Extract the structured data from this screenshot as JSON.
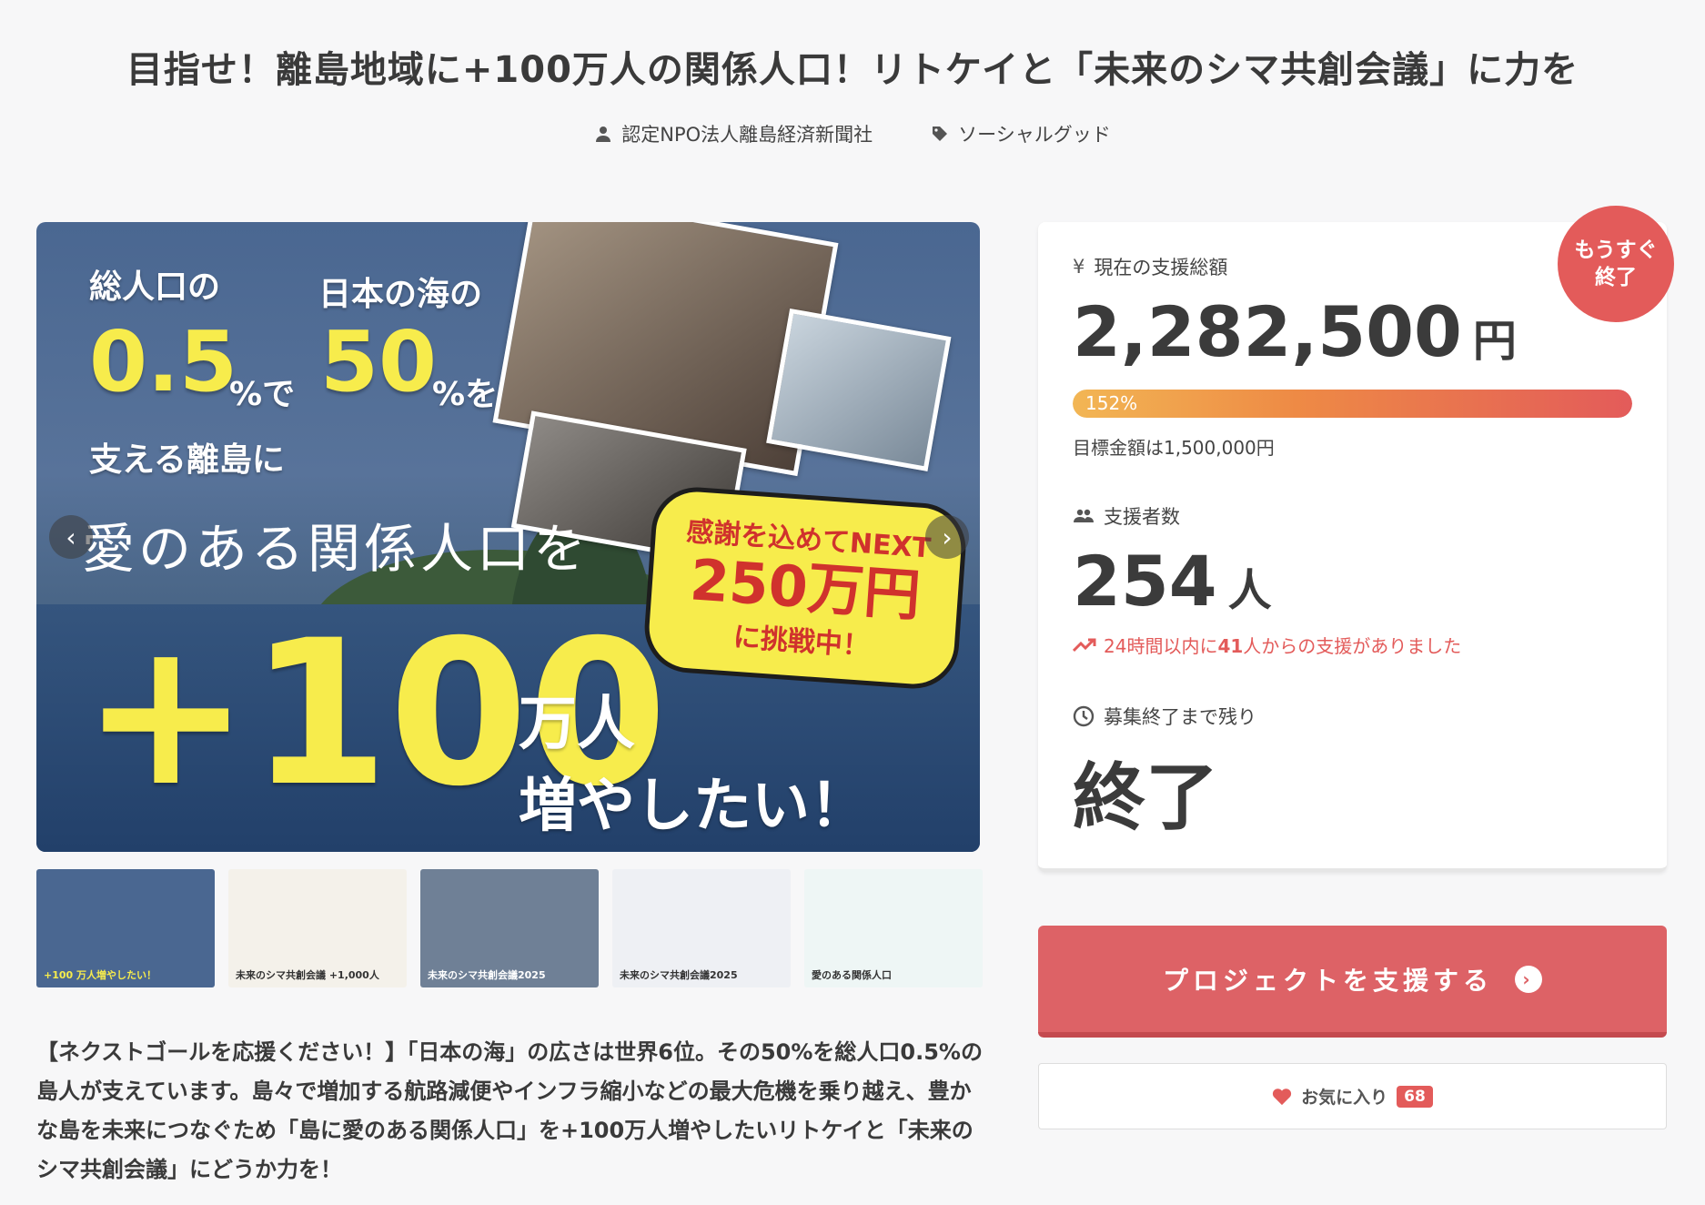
{
  "project": {
    "title": "目指せ！離島地域に+100万人の関係人口！リトケイと「未来のシマ共創会議」に力を",
    "owner": "認定NPO法人離島経済新聞社",
    "category": "ソーシャルグッド"
  },
  "hero": {
    "line1": "総人口の",
    "line2": "日本の海の",
    "num1": "0.5",
    "unit1": "%で",
    "num2": "50",
    "unit2": "%を",
    "line3": "支える離島に",
    "script": "愛のある関係人口を",
    "plus": "+100",
    "man": "万人",
    "want": "増やしたい！",
    "bubble_top": "感謝を込めてNEXT",
    "bubble_amount": "250万円",
    "bubble_bottom": "に挑戦中！",
    "prev_label": "‹",
    "next_label": "›"
  },
  "thumbnails": [
    {
      "caption": "+100 万人増やしたい！",
      "bg": "#4a6791"
    },
    {
      "caption": "未来のシマ共創会議 +1,000人",
      "bg": "#f4f1ea"
    },
    {
      "caption": "未来のシマ共創会議2025",
      "bg": "#6f8096"
    },
    {
      "caption": "未来のシマ共創会議2025",
      "bg": "#eef0f4"
    },
    {
      "caption": "愛のある関係人口",
      "bg": "#eef6f5"
    }
  ],
  "description": "【ネクストゴールを応援ください！】「日本の海」の広さは世界6位。その50%を総人口0.5%の島人が支えています。島々で増加する航路減便やインフラ縮小などの最大危機を乗り越え、豊かな島を未来につなぐため「島に愛のある関係人口」を+100万人増やしたいリトケイと「未来のシマ共創会議」にどうか力を！",
  "stats": {
    "badge": "もうすぐ\n終了",
    "badge_l1": "もうすぐ",
    "badge_l2": "終了",
    "amount_label": "現在の支援総額",
    "amount": "2,282,500",
    "amount_unit": "円",
    "progress_percent": 152,
    "progress_text": "152%",
    "goal_text": "目標金額は1,500,000円",
    "supporters_label": "支援者数",
    "supporters": "254",
    "supporters_unit": "人",
    "trend_prefix": "24時間以内に",
    "trend_count": "41",
    "trend_suffix": "人からの支援がありました",
    "remaining_label": "募集終了まで残り",
    "remaining": "終了"
  },
  "actions": {
    "support_label": "プロジェクトを支援する",
    "favorite_label": "お気に入り",
    "favorite_count": "68"
  },
  "colors": {
    "accent": "#e35b5a",
    "button": "#dd6266",
    "hero_yellow": "#f7ec4c"
  }
}
